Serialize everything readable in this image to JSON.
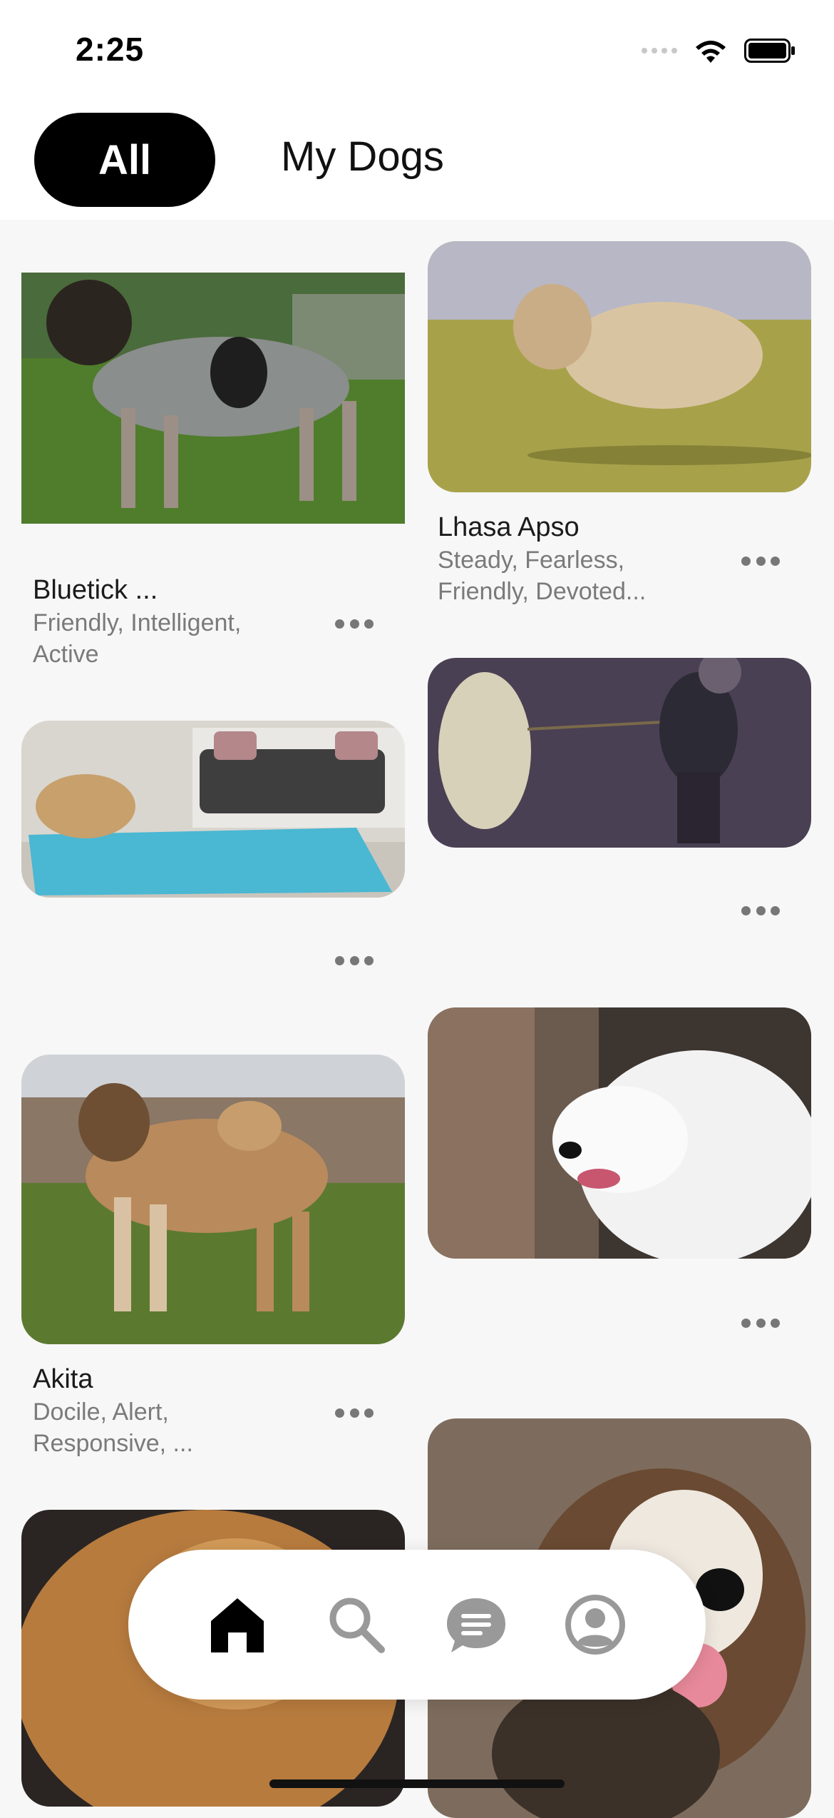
{
  "status_bar": {
    "time": "2:25"
  },
  "tabs": [
    {
      "label": "All",
      "active": true
    },
    {
      "label": "My Dogs",
      "active": false
    }
  ],
  "cards": [
    {
      "name": "Bluetick ...",
      "traits": [
        "Friendly, Intelligent,",
        "Active"
      ]
    },
    {
      "name": "Lhasa Apso",
      "traits": [
        "Steady, Fearless,",
        "Friendly, Devoted..."
      ]
    },
    {
      "name": "",
      "traits": []
    },
    {
      "name": "",
      "traits": []
    },
    {
      "name": "Akita",
      "traits": [
        "Docile, Alert,",
        "Responsive, ..."
      ]
    },
    {
      "name": "",
      "traits": []
    }
  ],
  "bottom_nav": [
    "home-icon",
    "search-icon",
    "chat-icon",
    "profile-icon"
  ],
  "colors": {
    "accent": "#000000",
    "background": "#f7f7f7",
    "muted_text": "#7a7a7a"
  }
}
